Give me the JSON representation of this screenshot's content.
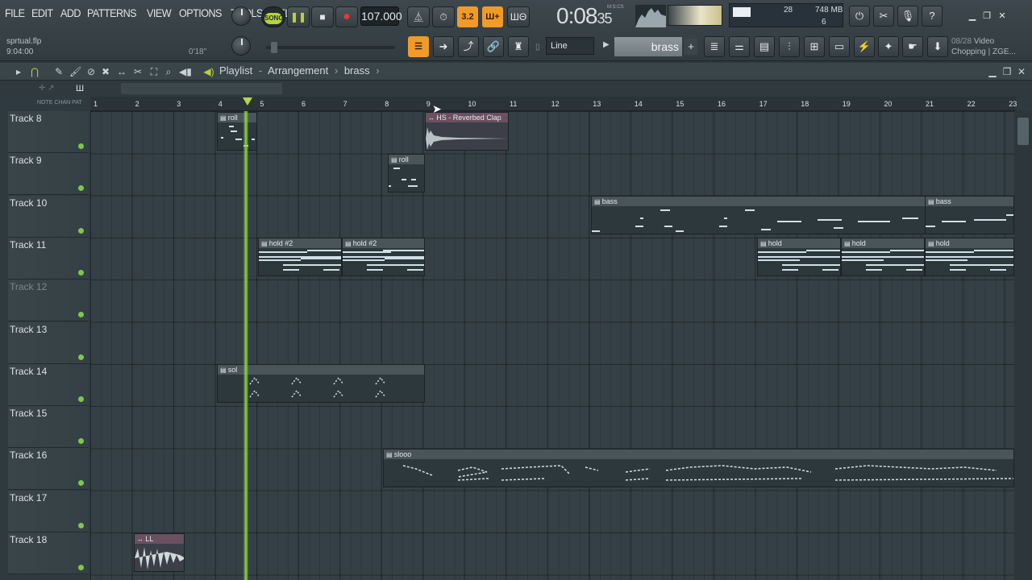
{
  "menu": [
    "FILE",
    "EDIT",
    "ADD",
    "PATTERNS",
    "VIEW",
    "OPTIONS",
    "TOOLS",
    "HELP"
  ],
  "file": {
    "name": "sprtual.flp",
    "time": "9:04:00"
  },
  "hint_time": "0'18\"",
  "transport": {
    "song_label": "SONG",
    "tempo": "107.000",
    "time_main": "0:08",
    "time_sub": "35",
    "mscs": "M:S:CS"
  },
  "monitor": {
    "poly": "28",
    "memory": "748 MB",
    "voices": "6"
  },
  "pattern_mode": "Line",
  "pattern_name": "brass",
  "news": {
    "date": "08/28",
    "text": "Video Chopping | ZGE..."
  },
  "playlist": {
    "title": "Playlist",
    "section": "Arrangement",
    "pattern": "brass"
  },
  "ruler": {
    "labels": "NOTE  CHAN  PAT",
    "bars": [
      "1",
      "2",
      "3",
      "4",
      "5",
      "6",
      "7",
      "8",
      "9",
      "10",
      "11",
      "12",
      "13",
      "14",
      "15",
      "16",
      "17",
      "18",
      "19",
      "20",
      "21",
      "22",
      "23"
    ]
  },
  "tracks": [
    "Track 8",
    "Track 9",
    "Track 10",
    "Track 11",
    "Track 12",
    "Track 13",
    "Track 14",
    "Track 15",
    "Track 16",
    "Track 17",
    "Track 18"
  ],
  "clips": {
    "roll_a": "roll",
    "roll_b": "roll",
    "reverbed_clap": "HS - Reverbed Clap",
    "bass_a": "bass",
    "bass_b": "bass",
    "hold2_a": "hold #2",
    "hold2_b": "hold #2",
    "hold_a": "hold",
    "hold_b": "hold",
    "hold_c": "hold",
    "sol": "sol",
    "slooo": "slooo",
    "ll": "LL"
  },
  "colors": {
    "accent": "#f09a2a",
    "playhead": "#8fd63c",
    "song": "#b9d23a"
  }
}
